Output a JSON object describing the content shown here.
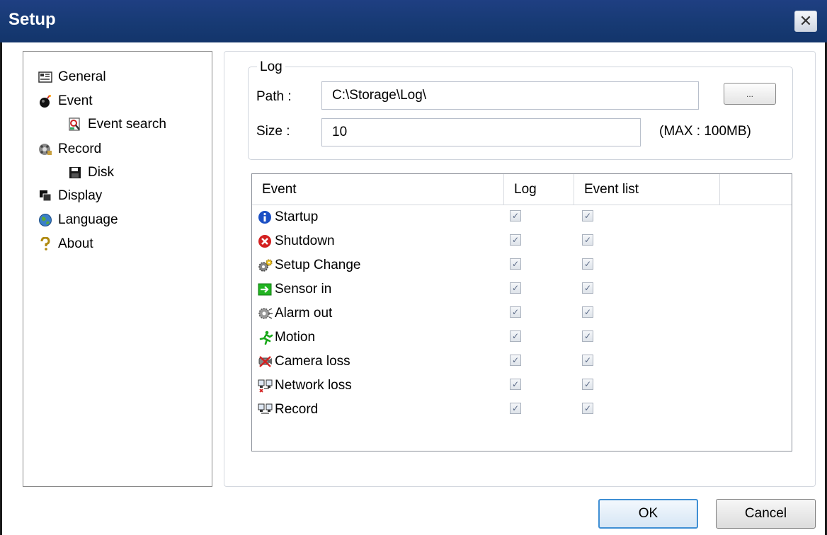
{
  "window": {
    "title": "Setup",
    "close_glyph": "✕"
  },
  "tree": {
    "items": [
      {
        "label": "General",
        "icon": "general-icon"
      },
      {
        "label": "Event",
        "icon": "event-icon"
      },
      {
        "label": "Event search",
        "icon": "event-search-icon"
      },
      {
        "label": "Record",
        "icon": "record-icon"
      },
      {
        "label": "Disk",
        "icon": "disk-icon"
      },
      {
        "label": "Display",
        "icon": "display-icon"
      },
      {
        "label": "Language",
        "icon": "globe-icon"
      },
      {
        "label": "About",
        "icon": "question-icon"
      }
    ]
  },
  "log": {
    "group_title": "Log",
    "path_label": "Path :",
    "path_value": "C:\\Storage\\Log\\",
    "browse_label": "...",
    "size_label": "Size :",
    "size_value": "10",
    "size_max": "(MAX : 100MB)"
  },
  "events": {
    "columns": [
      "Event",
      "Log",
      "Event list"
    ],
    "rows": [
      {
        "name": "Startup",
        "icon": "info-icon",
        "log": true,
        "event_list": true
      },
      {
        "name": "Shutdown",
        "icon": "shutdown-icon",
        "log": true,
        "event_list": true
      },
      {
        "name": "Setup Change",
        "icon": "gear-icon",
        "log": true,
        "event_list": true
      },
      {
        "name": "Sensor in",
        "icon": "sensor-in-icon",
        "log": true,
        "event_list": true
      },
      {
        "name": "Alarm out",
        "icon": "alarm-out-icon",
        "log": true,
        "event_list": true
      },
      {
        "name": "Motion",
        "icon": "motion-icon",
        "log": true,
        "event_list": true
      },
      {
        "name": "Camera loss",
        "icon": "camera-loss-icon",
        "log": true,
        "event_list": true
      },
      {
        "name": "Network loss",
        "icon": "network-loss-icon",
        "log": true,
        "event_list": true
      },
      {
        "name": "Record",
        "icon": "network-record-icon",
        "log": true,
        "event_list": true
      }
    ]
  },
  "footer": {
    "ok_label": "OK",
    "cancel_label": "Cancel"
  },
  "colors": {
    "title_bar": "#173a74",
    "ok_border": "#3f8fd4"
  }
}
